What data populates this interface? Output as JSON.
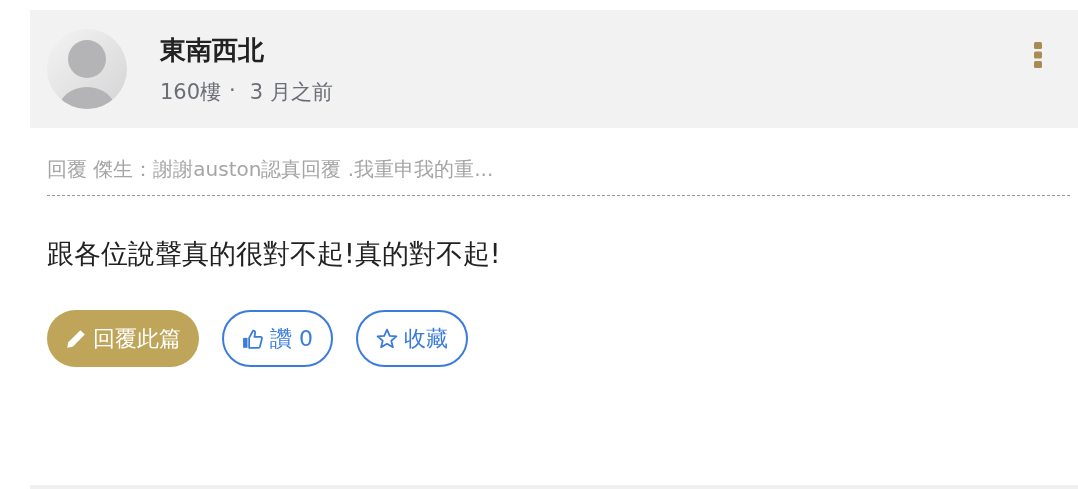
{
  "post": {
    "author": "東南西北",
    "floor": "160樓",
    "separator": "·",
    "time": "3 月之前",
    "quote": "回覆 傑生：謝謝auston認真回覆 .我重申我的重...",
    "body": "跟各位說聲真的很對不起!真的對不起!",
    "actions": [
      {
        "kind": "reply",
        "label": "回覆此篇"
      },
      {
        "kind": "like",
        "label": "讚 0"
      },
      {
        "kind": "favorite",
        "label": "收藏"
      }
    ]
  }
}
